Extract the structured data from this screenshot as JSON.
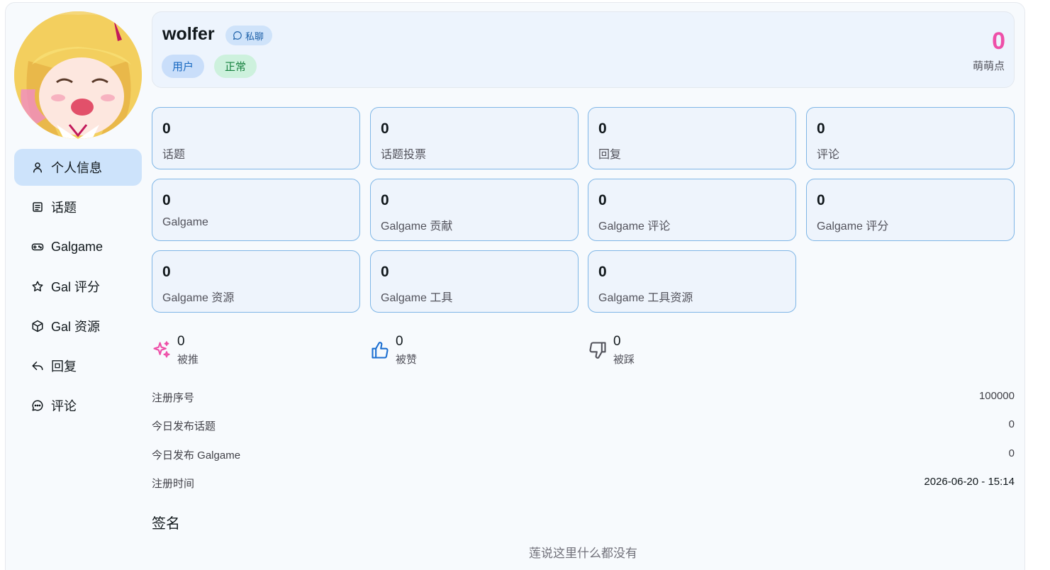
{
  "profile": {
    "username": "wolfer",
    "pm_label": "私聊",
    "role": "用户",
    "status": "正常",
    "moemoe_value": "0",
    "moemoe_label": "萌萌点"
  },
  "nav": [
    {
      "label": "个人信息",
      "icon": "user-icon",
      "active": true
    },
    {
      "label": "话题",
      "icon": "document-icon"
    },
    {
      "label": "Galgame",
      "icon": "gamepad-icon"
    },
    {
      "label": "Gal 评分",
      "icon": "star-icon"
    },
    {
      "label": "Gal 资源",
      "icon": "package-icon"
    },
    {
      "label": "回复",
      "icon": "reply-icon"
    },
    {
      "label": "评论",
      "icon": "comment-icon"
    }
  ],
  "stats": [
    {
      "value": "0",
      "label": "话题"
    },
    {
      "value": "0",
      "label": "话题投票"
    },
    {
      "value": "0",
      "label": "回复"
    },
    {
      "value": "0",
      "label": "评论"
    },
    {
      "value": "0",
      "label": "Galgame"
    },
    {
      "value": "0",
      "label": "Galgame 贡献"
    },
    {
      "value": "0",
      "label": "Galgame 评论"
    },
    {
      "value": "0",
      "label": "Galgame 评分"
    },
    {
      "value": "0",
      "label": "Galgame 资源"
    },
    {
      "value": "0",
      "label": "Galgame 工具"
    },
    {
      "value": "0",
      "label": "Galgame 工具资源"
    }
  ],
  "reactions": [
    {
      "value": "0",
      "label": "被推",
      "icon": "sparkles-icon",
      "color": "#ee4fa8"
    },
    {
      "value": "0",
      "label": "被赞",
      "icon": "thumbs-up-icon",
      "color": "#1c6fd1"
    },
    {
      "value": "0",
      "label": "被踩",
      "icon": "thumbs-down-icon",
      "color": "#52525b"
    }
  ],
  "info": [
    {
      "key": "注册序号",
      "value": "100000"
    },
    {
      "key": "今日发布话题",
      "value": "0"
    },
    {
      "key": "今日发布 Galgame",
      "value": "0"
    },
    {
      "key": "注册时间",
      "value": "2026-06-20 - 15:14"
    }
  ],
  "signature": {
    "title": "签名",
    "empty_text": "莲说这里什么都没有"
  }
}
